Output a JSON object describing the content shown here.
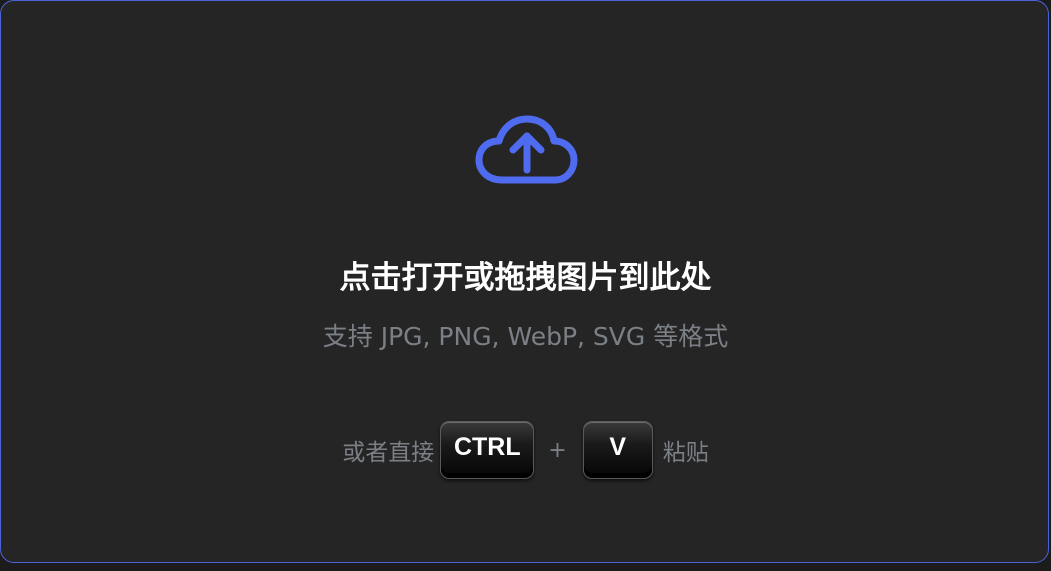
{
  "dropzone": {
    "title": "点击打开或拖拽图片到此处",
    "formats": "支持 JPG, PNG, WebP, SVG 等格式",
    "icon": "cloud-upload-icon",
    "accent_color": "#4f6cf0"
  },
  "paste_hint": {
    "prefix": "或者直接",
    "key_1": "CTRL",
    "separator": "+",
    "key_2": "V",
    "suffix": "粘贴"
  }
}
